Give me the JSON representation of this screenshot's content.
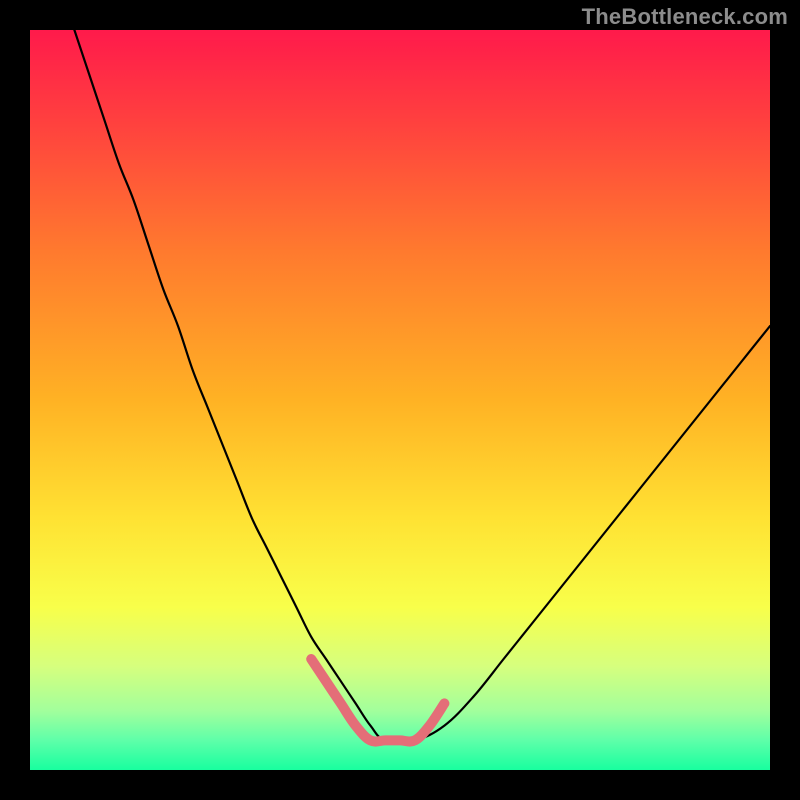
{
  "watermark": {
    "text": "TheBottleneck.com"
  },
  "chart_data": {
    "type": "line",
    "title": "",
    "xlabel": "",
    "ylabel": "",
    "xlim": [
      0,
      100
    ],
    "ylim": [
      0,
      100
    ],
    "grid": false,
    "legend": false,
    "background_gradient_stops": [
      {
        "offset": 0.0,
        "color": "#ff1a4b"
      },
      {
        "offset": 0.12,
        "color": "#ff3f3f"
      },
      {
        "offset": 0.3,
        "color": "#ff7a2e"
      },
      {
        "offset": 0.5,
        "color": "#ffb224"
      },
      {
        "offset": 0.66,
        "color": "#ffe233"
      },
      {
        "offset": 0.78,
        "color": "#f8ff4a"
      },
      {
        "offset": 0.86,
        "color": "#d6ff7e"
      },
      {
        "offset": 0.92,
        "color": "#a2ff9c"
      },
      {
        "offset": 0.96,
        "color": "#5effa9"
      },
      {
        "offset": 1.0,
        "color": "#18ff9f"
      }
    ],
    "series": [
      {
        "name": "bottleneck-curve",
        "stroke": "#000000",
        "stroke_width": 2.2,
        "x": [
          6,
          8,
          10,
          12,
          14,
          16,
          18,
          20,
          22,
          24,
          26,
          28,
          30,
          32,
          34,
          36,
          38,
          40,
          42,
          44,
          46,
          48,
          52,
          56,
          60,
          64,
          68,
          72,
          76,
          80,
          84,
          88,
          92,
          96,
          100
        ],
        "y": [
          100,
          94,
          88,
          82,
          77,
          71,
          65,
          60,
          54,
          49,
          44,
          39,
          34,
          30,
          26,
          22,
          18,
          15,
          12,
          9,
          6,
          4,
          4,
          6,
          10,
          15,
          20,
          25,
          30,
          35,
          40,
          45,
          50,
          55,
          60
        ]
      },
      {
        "name": "optimal-zone-highlight",
        "stroke": "#e46e78",
        "stroke_width": 10,
        "x": [
          38,
          40,
          42,
          44,
          46,
          48,
          50,
          52,
          54,
          56
        ],
        "y": [
          15,
          12,
          9,
          6,
          4,
          4,
          4,
          4,
          6,
          9
        ]
      }
    ]
  }
}
